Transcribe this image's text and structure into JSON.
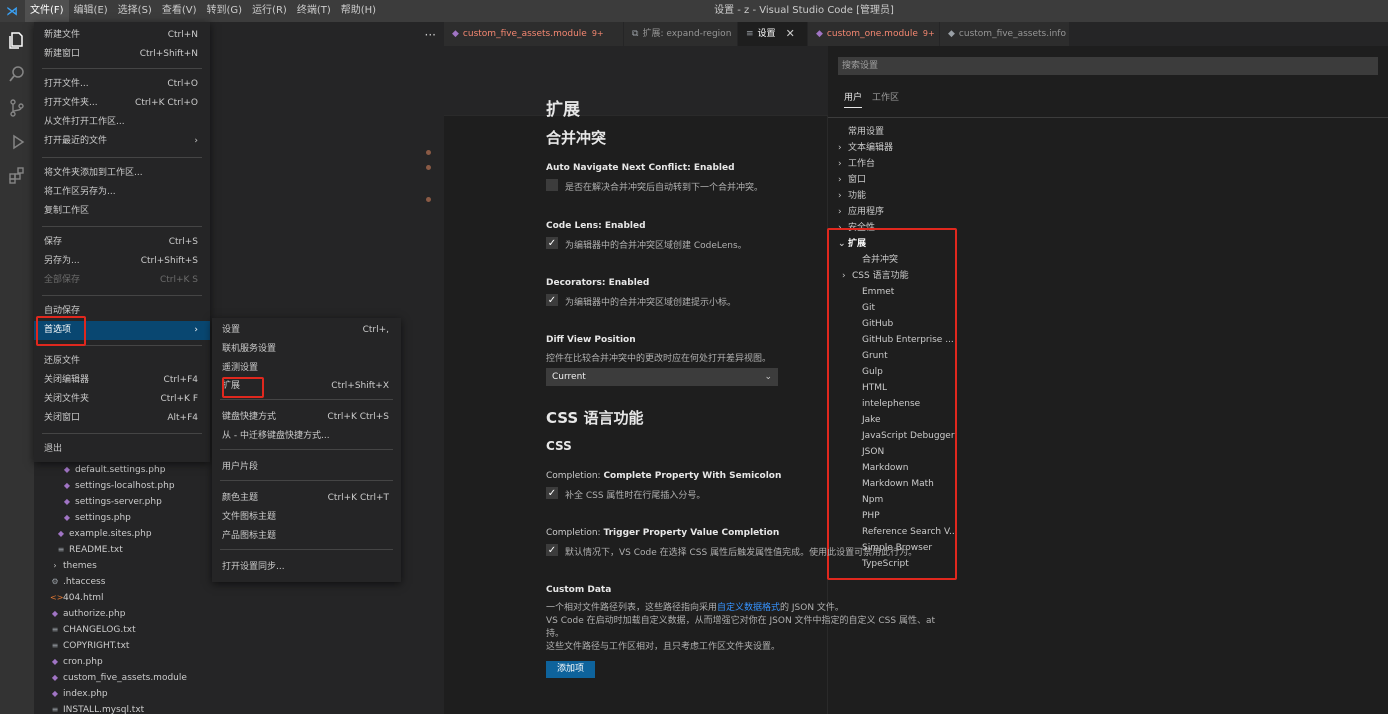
{
  "titlebar": {
    "title": "设置 - z - Visual Studio Code [管理员]",
    "menus": [
      "文件(F)",
      "编辑(E)",
      "选择(S)",
      "查看(V)",
      "转到(G)",
      "运行(R)",
      "终端(T)",
      "帮助(H)"
    ]
  },
  "activity_icons": [
    "files-icon",
    "search-icon",
    "source-control-icon",
    "run-debug-icon",
    "extensions-icon"
  ],
  "file_menu": {
    "items": [
      {
        "label": "新建文件",
        "shortcut": "Ctrl+N"
      },
      {
        "label": "新建窗口",
        "shortcut": "Ctrl+Shift+N"
      },
      {
        "label": "打开文件...",
        "shortcut": "Ctrl+O"
      },
      {
        "label": "打开文件夹...",
        "shortcut": "Ctrl+K Ctrl+O"
      },
      {
        "label": "从文件打开工作区...",
        "shortcut": ""
      },
      {
        "label": "打开最近的文件",
        "shortcut": "›"
      },
      {
        "label": "将文件夹添加到工作区...",
        "shortcut": ""
      },
      {
        "label": "将工作区另存为...",
        "shortcut": ""
      },
      {
        "label": "复制工作区",
        "shortcut": ""
      },
      {
        "label": "保存",
        "shortcut": "Ctrl+S"
      },
      {
        "label": "另存为...",
        "shortcut": "Ctrl+Shift+S"
      },
      {
        "label": "全部保存",
        "shortcut": "Ctrl+K S"
      },
      {
        "label": "自动保存",
        "shortcut": ""
      },
      {
        "label": "首选项",
        "shortcut": "›"
      },
      {
        "label": "还原文件",
        "shortcut": ""
      },
      {
        "label": "关闭编辑器",
        "shortcut": "Ctrl+F4"
      },
      {
        "label": "关闭文件夹",
        "shortcut": "Ctrl+K F"
      },
      {
        "label": "关闭窗口",
        "shortcut": "Alt+F4"
      },
      {
        "label": "退出",
        "shortcut": ""
      }
    ]
  },
  "pref_menu": {
    "items": [
      {
        "label": "设置",
        "shortcut": "Ctrl+,"
      },
      {
        "label": "联机服务设置",
        "shortcut": ""
      },
      {
        "label": "遥测设置",
        "shortcut": ""
      },
      {
        "label": "扩展",
        "shortcut": "Ctrl+Shift+X"
      },
      {
        "label": "键盘快捷方式",
        "shortcut": "Ctrl+K Ctrl+S"
      },
      {
        "label": "从 - 中迁移键盘快捷方式...",
        "shortcut": ""
      },
      {
        "label": "用户片段",
        "shortcut": ""
      },
      {
        "label": "颜色主题",
        "shortcut": "Ctrl+K Ctrl+T"
      },
      {
        "label": "文件图标主题",
        "shortcut": ""
      },
      {
        "label": "产品图标主题",
        "shortcut": ""
      },
      {
        "label": "打开设置同步...",
        "shortcut": ""
      }
    ]
  },
  "explorer": {
    "more_icon": "···",
    "rows": [
      {
        "label": "default.settings.php",
        "icon": "php-icon",
        "glyph": "◆"
      },
      {
        "label": "settings-localhost.php",
        "icon": "php-icon",
        "glyph": "◆"
      },
      {
        "label": "settings-server.php",
        "icon": "php-icon",
        "glyph": "◆"
      },
      {
        "label": "settings.php",
        "icon": "php-icon",
        "glyph": "◆"
      },
      {
        "label": "example.sites.php",
        "icon": "php-icon",
        "glyph": "◆"
      },
      {
        "label": "README.txt",
        "icon": "text-file-icon",
        "glyph": "≡"
      },
      {
        "label": "themes",
        "icon": "chevron-right-icon",
        "glyph": "›"
      },
      {
        "label": ".htaccess",
        "icon": "gear-icon",
        "glyph": "⚙"
      },
      {
        "label": "404.html",
        "icon": "html-icon",
        "glyph": "<>"
      },
      {
        "label": "authorize.php",
        "icon": "php-icon",
        "glyph": "◆"
      },
      {
        "label": "CHANGELOG.txt",
        "icon": "text-file-icon",
        "glyph": "≡"
      },
      {
        "label": "COPYRIGHT.txt",
        "icon": "text-file-icon",
        "glyph": "≡"
      },
      {
        "label": "cron.php",
        "icon": "php-icon",
        "glyph": "◆"
      },
      {
        "label": "custom_five_assets.module",
        "icon": "php-icon",
        "glyph": "◆"
      },
      {
        "label": "index.php",
        "icon": "php-icon",
        "glyph": "◆"
      },
      {
        "label": "INSTALL.mysql.txt",
        "icon": "text-file-icon",
        "glyph": "≡"
      }
    ]
  },
  "tabs": [
    {
      "label": "custom_five_assets.module",
      "count": "9+",
      "error": true,
      "icon": "php-icon"
    },
    {
      "label": "扩展: expand-region",
      "count": "",
      "error": false,
      "icon": "extension-icon"
    },
    {
      "label": "设置",
      "count": "",
      "error": false,
      "icon": "settings-icon",
      "active": true
    },
    {
      "label": "custom_one.module",
      "count": "9+",
      "error": true,
      "icon": "php-icon"
    },
    {
      "label": "custom_five_assets.info",
      "count": "",
      "error": false,
      "icon": "file-icon"
    }
  ],
  "settings": {
    "search_placeholder": "搜索设置",
    "scope_tabs": [
      "用户",
      "工作区"
    ],
    "toc": [
      {
        "label": "常用设置",
        "chev": "",
        "bold": false
      },
      {
        "label": "文本编辑器",
        "chev": "›",
        "bold": false
      },
      {
        "label": "工作台",
        "chev": "›",
        "bold": false
      },
      {
        "label": "窗口",
        "chev": "›",
        "bold": false
      },
      {
        "label": "功能",
        "chev": "›",
        "bold": false
      },
      {
        "label": "应用程序",
        "chev": "›",
        "bold": false
      },
      {
        "label": "安全性",
        "chev": "›",
        "bold": false
      },
      {
        "label": "扩展",
        "chev": "⌄",
        "bold": true
      },
      {
        "label": "合并冲突",
        "chev": "",
        "bold": false
      },
      {
        "label": "CSS 语言功能",
        "chev": "›",
        "bold": false
      },
      {
        "label": "Emmet",
        "chev": "",
        "bold": false
      },
      {
        "label": "Git",
        "chev": "",
        "bold": false
      },
      {
        "label": "GitHub",
        "chev": "",
        "bold": false
      },
      {
        "label": "GitHub Enterprise ...",
        "chev": "",
        "bold": false
      },
      {
        "label": "Grunt",
        "chev": "",
        "bold": false
      },
      {
        "label": "Gulp",
        "chev": "",
        "bold": false
      },
      {
        "label": "HTML",
        "chev": "",
        "bold": false
      },
      {
        "label": "intelephense",
        "chev": "",
        "bold": false
      },
      {
        "label": "Jake",
        "chev": "",
        "bold": false
      },
      {
        "label": "JavaScript Debugger",
        "chev": "",
        "bold": false
      },
      {
        "label": "JSON",
        "chev": "",
        "bold": false
      },
      {
        "label": "Markdown",
        "chev": "",
        "bold": false
      },
      {
        "label": "Markdown Math",
        "chev": "",
        "bold": false
      },
      {
        "label": "Npm",
        "chev": "",
        "bold": false
      },
      {
        "label": "PHP",
        "chev": "",
        "bold": false
      },
      {
        "label": "Reference Search V...",
        "chev": "",
        "bold": false
      },
      {
        "label": "Simple Browser",
        "chev": "",
        "bold": false
      },
      {
        "label": "TypeScript",
        "chev": "",
        "bold": false
      }
    ],
    "content": {
      "section_title": "扩展",
      "merge_title": "合并冲突",
      "auto_nav_label": "Auto Navigate Next Conflict: ",
      "auto_nav_value": "Enabled",
      "auto_nav_desc": "是否在解决合并冲突后自动转到下一个合并冲突。",
      "auto_nav_checked": false,
      "codelens_label": "Code Lens: ",
      "codelens_value": "Enabled",
      "codelens_desc": "为编辑器中的合并冲突区域创建 CodeLens。",
      "codelens_checked": true,
      "decorators_label": "Decorators: ",
      "decorators_value": "Enabled",
      "decorators_desc": "为编辑器中的合并冲突区域创建提示小标。",
      "decorators_checked": true,
      "diff_label": "Diff View Position",
      "diff_desc": "控件在比较合并冲突中的更改时应在何处打开差异视图。",
      "diff_value": "Current",
      "css_title": "CSS 语言功能",
      "css_sub": "CSS",
      "completion1_prefix": "Completion: ",
      "completion1_label": "Complete Property With Semicolon",
      "completion1_desc": "补全 CSS 属性时在行尾插入分号。",
      "completion1_checked": true,
      "completion2_prefix": "Completion: ",
      "completion2_label": "Trigger Property Value Completion",
      "completion2_desc": "默认情况下，VS Code 在选择 CSS 属性后触发属性值完成。使用此设置可禁用此行为。",
      "completion2_checked": true,
      "custom_label": "Custom Data",
      "custom_desc1_a": "一个相对文件路径列表，这些路径指向采用",
      "custom_desc1_link": "自定义数据格式",
      "custom_desc1_b": "的 JSON 文件。",
      "custom_desc2": "VS Code 在启动时加载自定义数据，从而增强它对你在 JSON 文件中指定的自定义 CSS 属性、at",
      "custom_desc3": "持。",
      "custom_desc4": "这些文件路径与工作区相对，且只考虑工作区文件夹设置。",
      "add_button": "添加项"
    }
  }
}
